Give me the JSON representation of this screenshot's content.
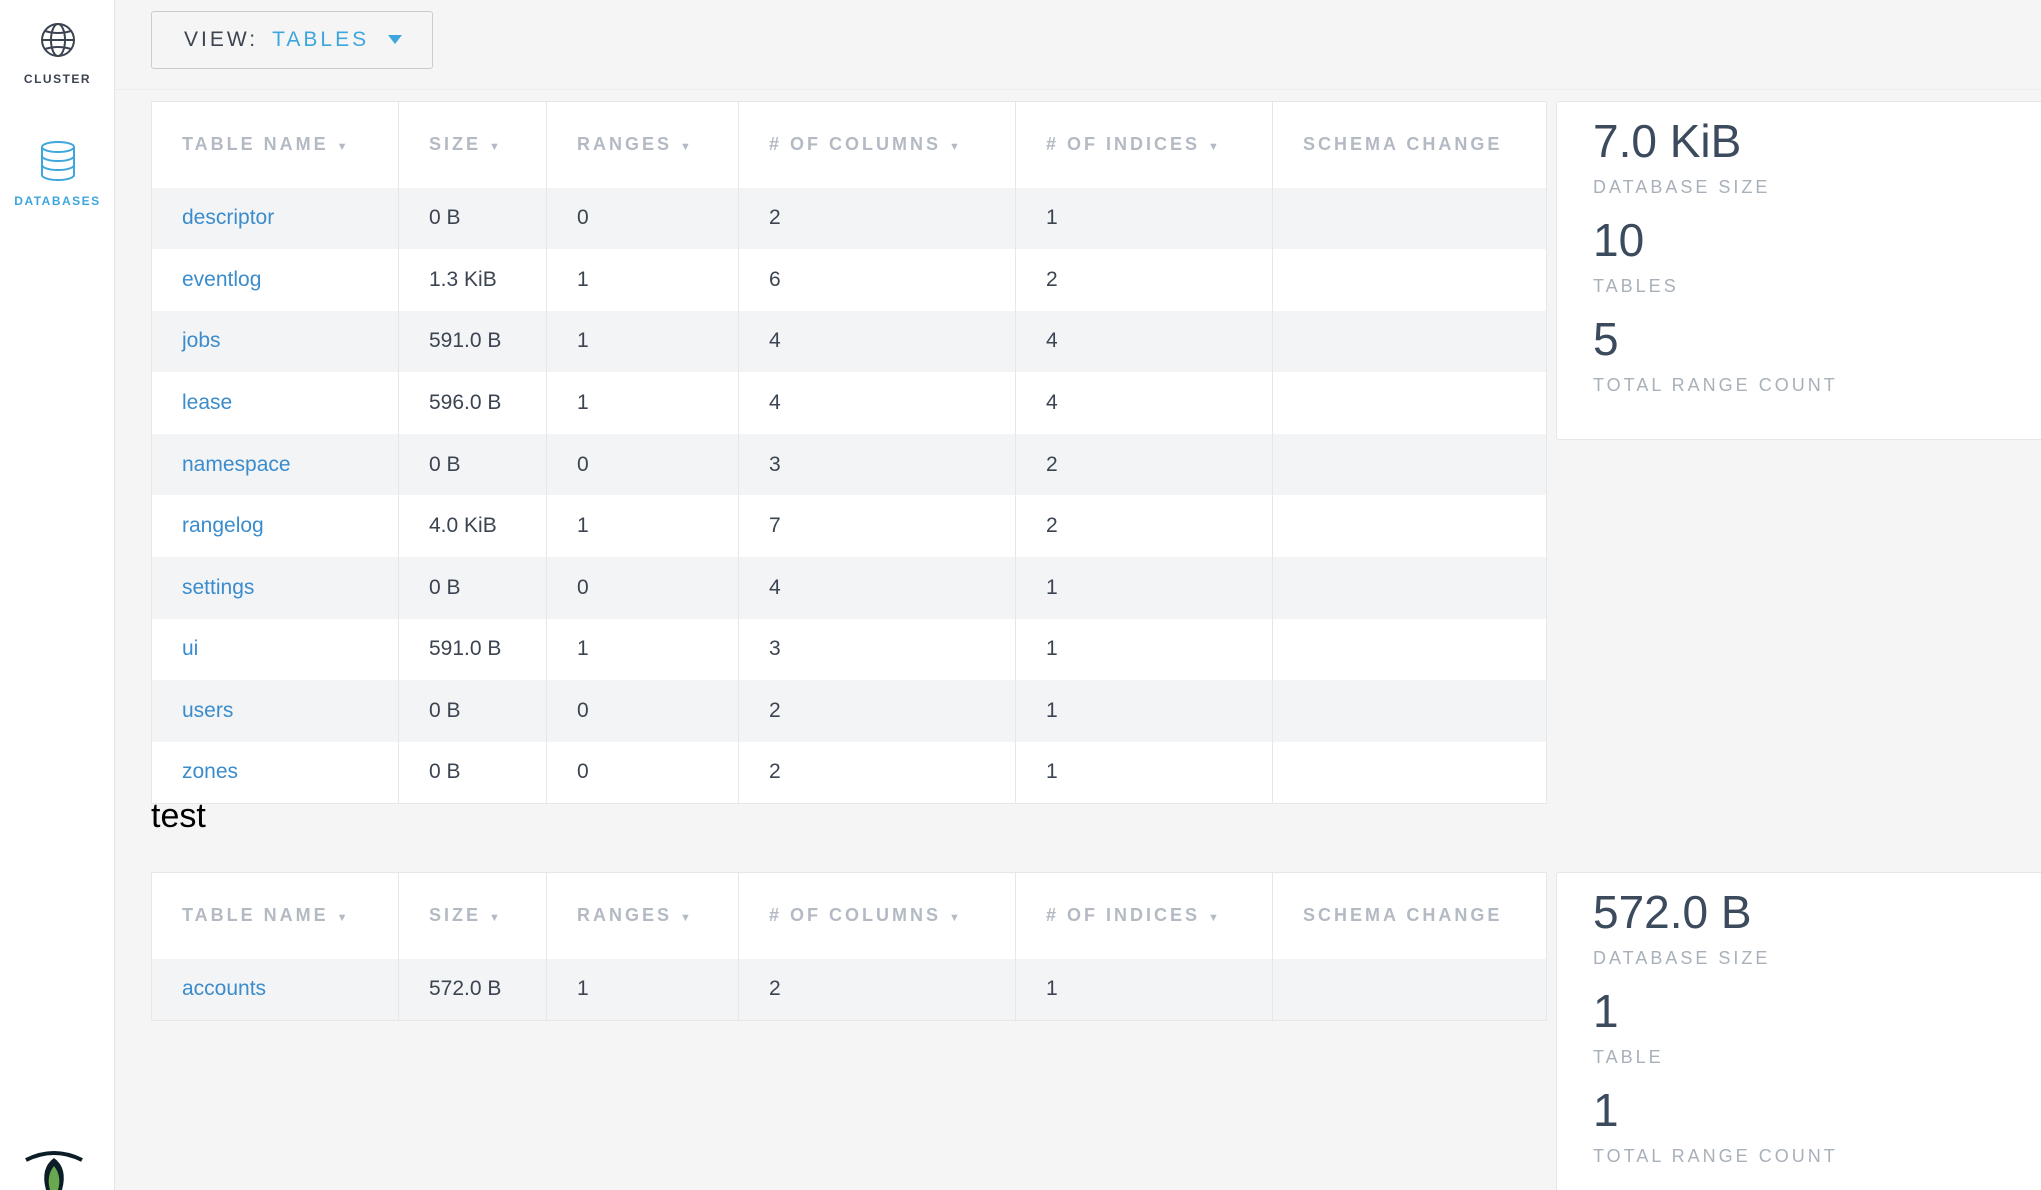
{
  "sidebar": {
    "items": [
      {
        "label": "CLUSTER",
        "icon": "globe-icon",
        "active": false
      },
      {
        "label": "DATABASES",
        "icon": "database-icon",
        "active": true
      }
    ],
    "logo": "cockroach-logo"
  },
  "header": {
    "view_label": "VIEW:",
    "view_value": "TABLES"
  },
  "columns": [
    {
      "label": "TABLE NAME",
      "sortable": true
    },
    {
      "label": "SIZE",
      "sortable": true
    },
    {
      "label": "RANGES",
      "sortable": true
    },
    {
      "label": "# OF COLUMNS",
      "sortable": true
    },
    {
      "label": "# OF INDICES",
      "sortable": true
    },
    {
      "label": "SCHEMA CHANGE",
      "sortable": false
    }
  ],
  "databases": [
    {
      "title": "",
      "rows": [
        {
          "name": "descriptor",
          "size": "0 B",
          "ranges": "0",
          "columns": "2",
          "indices": "1",
          "schema": ""
        },
        {
          "name": "eventlog",
          "size": "1.3 KiB",
          "ranges": "1",
          "columns": "6",
          "indices": "2",
          "schema": ""
        },
        {
          "name": "jobs",
          "size": "591.0 B",
          "ranges": "1",
          "columns": "4",
          "indices": "4",
          "schema": ""
        },
        {
          "name": "lease",
          "size": "596.0 B",
          "ranges": "1",
          "columns": "4",
          "indices": "4",
          "schema": ""
        },
        {
          "name": "namespace",
          "size": "0 B",
          "ranges": "0",
          "columns": "3",
          "indices": "2",
          "schema": ""
        },
        {
          "name": "rangelog",
          "size": "4.0 KiB",
          "ranges": "1",
          "columns": "7",
          "indices": "2",
          "schema": ""
        },
        {
          "name": "settings",
          "size": "0 B",
          "ranges": "0",
          "columns": "4",
          "indices": "1",
          "schema": ""
        },
        {
          "name": "ui",
          "size": "591.0 B",
          "ranges": "1",
          "columns": "3",
          "indices": "1",
          "schema": ""
        },
        {
          "name": "users",
          "size": "0 B",
          "ranges": "0",
          "columns": "2",
          "indices": "1",
          "schema": ""
        },
        {
          "name": "zones",
          "size": "0 B",
          "ranges": "0",
          "columns": "2",
          "indices": "1",
          "schema": ""
        }
      ],
      "summary": {
        "database_size": "7.0 KiB",
        "database_size_label": "DATABASE SIZE",
        "tables": "10",
        "tables_label": "TABLES",
        "range_count": "5",
        "range_count_label": "TOTAL RANGE COUNT"
      }
    },
    {
      "title": "test",
      "rows": [
        {
          "name": "accounts",
          "size": "572.0 B",
          "ranges": "1",
          "columns": "2",
          "indices": "1",
          "schema": ""
        }
      ],
      "summary": {
        "database_size": "572.0 B",
        "database_size_label": "DATABASE SIZE",
        "tables": "1",
        "tables_label": "TABLE",
        "range_count": "1",
        "range_count_label": "TOTAL RANGE COUNT"
      }
    }
  ],
  "colors": {
    "accent": "#3ea6dd",
    "link": "#3b8ccc",
    "text": "#3b4450",
    "muted": "#b3bac3"
  }
}
